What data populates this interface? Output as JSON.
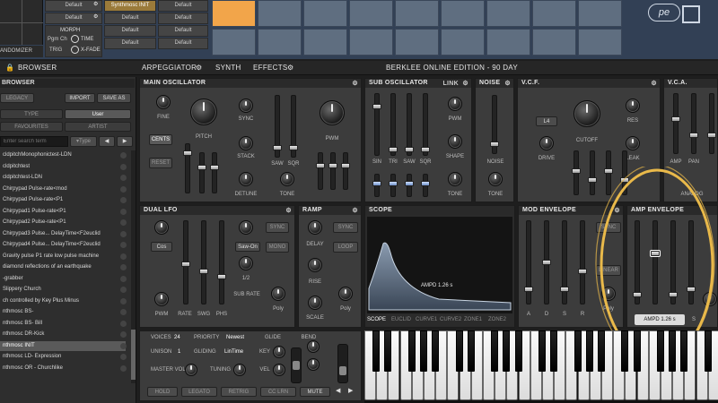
{
  "top": {
    "presets": [
      "Default",
      "Default",
      "Default",
      "Default",
      "Default",
      "Default",
      "Default",
      "Default"
    ],
    "active_preset": "Synthmosc INIT",
    "morph_label": "MORPH",
    "pgm_ch_label": "Pgm Ch",
    "time_label": "TIME",
    "trig_label": "TRIG",
    "xfade_label": "X-FADE",
    "randomizer_label": "ANDOMIZER",
    "logo": "pe"
  },
  "nav": {
    "browser": "BROWSER",
    "arpeggiator": "ARPEGGIATOR",
    "synth": "SYNTH",
    "effects": "EFFECTS",
    "edition": "BERKLEE ONLINE EDITION - 90 DAY"
  },
  "browser": {
    "title": "BROWSER",
    "legacy": "LEGACY",
    "import": "IMPORT",
    "save_as": "SAVE AS",
    "type_tab": "TYPE",
    "user_tab": "User",
    "favourites_tab": "FAVOURITES",
    "artist_tab": "ARTIST",
    "search_placeholder": "Enter search term",
    "type_filter": "Type",
    "items": [
      "cldpitchMonophonictest-LDN",
      "cldpitchtest",
      "cldpitchtest-LDN",
      "Chirpypad Pulse-rate<mod",
      "Chirpypad Pulse-rate<P1",
      "Chirpypad1 Pulse-rate<P1",
      "Chirpypad2 Pulse-rate<P1",
      "Chirpypad3 Pulse... DelayTime<F2euclid",
      "Chirpypad4 Pulse... DelayTime<F2euclid",
      "Gravity pulse P1 rate low pulse machine",
      "diamond reflections of an earthquake",
      "-grabber",
      "Slippery Church",
      "ch controlled by Key Plus Minus",
      "nthmosc BS-",
      "nthmosc BS- Bill",
      "nthmosc DR-Kick",
      "nthmosc INIT",
      "nthmosc LD- Expression",
      "nthmosc OR - Churchlike"
    ],
    "selected_index": 17
  },
  "main_osc": {
    "title": "MAIN OSCILLATOR",
    "fine": "FINE",
    "pitch": "PITCH",
    "cents": "CENTS",
    "reset": "RESET",
    "sync": "SYNC",
    "stack": "STACK",
    "detune": "DETUNE",
    "saw": "SAW",
    "sqr": "SQR",
    "tone": "TONE",
    "pwm": "PWM"
  },
  "sub_osc": {
    "title": "SUB OSCILLATOR",
    "link": "LINK",
    "sin": "SIN",
    "tri": "TRI",
    "saw": "SAW",
    "sqr": "SQR",
    "pwm": "PWM",
    "shape": "SHAPE",
    "tone": "TONE"
  },
  "noise": {
    "title": "NOISE",
    "noise": "NOISE",
    "tone": "TONE"
  },
  "vcf": {
    "title": "V.C.F.",
    "mode": "L4",
    "cutoff": "CUTOFF",
    "res": "RES",
    "drive": "DRIVE",
    "leak": "LEAK"
  },
  "vca": {
    "title": "V.C.A.",
    "amp": "AMP",
    "pan": "PAN",
    "analog": "ANALOG"
  },
  "lfo": {
    "title": "DUAL LFO",
    "wave": "Cos",
    "sync": "SYNC",
    "mono": "MONO",
    "sync_mode": "Saw-On",
    "rate_frac": "1/2",
    "sub_rate": "SUB RATE",
    "pwm": "PWM",
    "rate": "RATE",
    "swg": "SWG",
    "phs": "PHS",
    "poly": "Poly"
  },
  "ramp": {
    "title": "RAMP",
    "delay": "DELAY",
    "rise": "RISE",
    "scale": "SCALE",
    "sync": "SYNC",
    "loop": "LOOP",
    "poly": "Poly"
  },
  "scope": {
    "title": "SCOPE",
    "readout": "AMPD 1.26 s",
    "tabs": [
      "SCOPE",
      "EUCLID",
      "CURVE1",
      "CURVE2",
      "ZONE1",
      "ZONE2"
    ]
  },
  "mod_env": {
    "title": "MOD ENVELOPE",
    "a": "A",
    "d": "D",
    "s": "S",
    "r": "R",
    "sync": "SYNC",
    "linear": "LINEAR",
    "poly": "Poly"
  },
  "amp_env": {
    "title": "AMP ENVELOPE",
    "readout": "AMPD 1.26 s",
    "s": "S"
  },
  "perf": {
    "voices_label": "VOICES",
    "voices": "24",
    "priority_label": "PRIORITY",
    "priority": "Newest",
    "glide": "GLIDE",
    "bend": "BEND",
    "unison_label": "UNISON",
    "unison": "1",
    "gliding_label": "GLIDING",
    "gliding": "LinTime",
    "key": "KEY",
    "master_vol": "MASTER VOL",
    "tuning": "TUNING",
    "vel": "VEL",
    "hold": "HOLD",
    "legato": "LEGATO",
    "retrig": "RETRIG",
    "cc_lrn": "CC LRN",
    "mute": "MUTE"
  }
}
